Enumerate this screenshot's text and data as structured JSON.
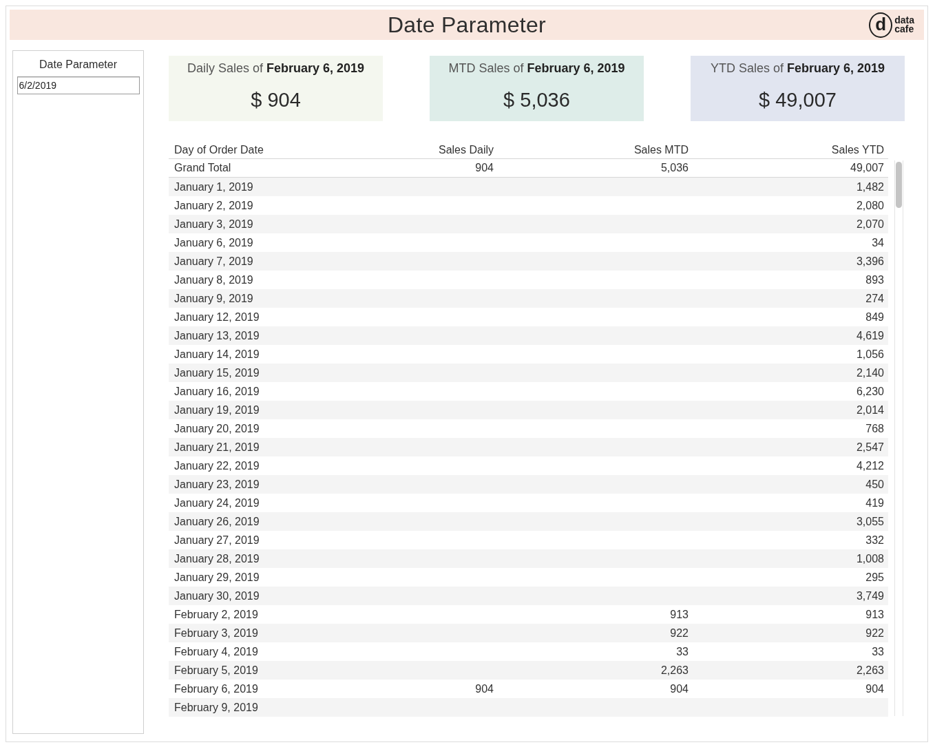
{
  "dashboard": {
    "title": "Date Parameter",
    "logo": {
      "mark": "d",
      "lines": [
        "data",
        "cafe"
      ]
    }
  },
  "parameter": {
    "label": "Date Parameter",
    "value": "6/2/2019"
  },
  "cards": [
    {
      "title": "Daily Sales of **February 6, 2019**",
      "value": "$ 904",
      "color": "#f4f7ef"
    },
    {
      "title": "MTD Sales of **February 6, 2019**",
      "value": "$ 5,036",
      "color": "#deede9"
    },
    {
      "title": "YTD Sales of **February 6, 2019**",
      "value": "$ 49,007",
      "color": "#e1e5f0"
    }
  ],
  "table": {
    "columns": [
      "Day of Order Date",
      "Sales Daily",
      "Sales MTD",
      "Sales YTD"
    ],
    "grand_total": {
      "label": "Grand Total",
      "sales_daily": "904",
      "sales_mtd": "5,036",
      "sales_ytd": "49,007"
    },
    "rows": [
      {
        "date": "January 1, 2019",
        "sales_ytd": "1,482"
      },
      {
        "date": "January 2, 2019",
        "sales_ytd": "2,080"
      },
      {
        "date": "January 3, 2019",
        "sales_ytd": "2,070"
      },
      {
        "date": "January 6, 2019",
        "sales_ytd": "34"
      },
      {
        "date": "January 7, 2019",
        "sales_ytd": "3,396"
      },
      {
        "date": "January 8, 2019",
        "sales_ytd": "893"
      },
      {
        "date": "January 9, 2019",
        "sales_ytd": "274"
      },
      {
        "date": "January 12, 2019",
        "sales_ytd": "849"
      },
      {
        "date": "January 13, 2019",
        "sales_ytd": "4,619"
      },
      {
        "date": "January 14, 2019",
        "sales_ytd": "1,056"
      },
      {
        "date": "January 15, 2019",
        "sales_ytd": "2,140"
      },
      {
        "date": "January 16, 2019",
        "sales_ytd": "6,230"
      },
      {
        "date": "January 19, 2019",
        "sales_ytd": "2,014"
      },
      {
        "date": "January 20, 2019",
        "sales_ytd": "768"
      },
      {
        "date": "January 21, 2019",
        "sales_ytd": "2,547"
      },
      {
        "date": "January 22, 2019",
        "sales_ytd": "4,212"
      },
      {
        "date": "January 23, 2019",
        "sales_ytd": "450"
      },
      {
        "date": "January 24, 2019",
        "sales_ytd": "419"
      },
      {
        "date": "January 26, 2019",
        "sales_ytd": "3,055"
      },
      {
        "date": "January 27, 2019",
        "sales_ytd": "332"
      },
      {
        "date": "January 28, 2019",
        "sales_ytd": "1,008"
      },
      {
        "date": "January 29, 2019",
        "sales_ytd": "295"
      },
      {
        "date": "January 30, 2019",
        "sales_ytd": "3,749"
      },
      {
        "date": "February 2, 2019",
        "sales_mtd": "913",
        "sales_ytd": "913"
      },
      {
        "date": "February 3, 2019",
        "sales_mtd": "922",
        "sales_ytd": "922"
      },
      {
        "date": "February 4, 2019",
        "sales_mtd": "33",
        "sales_ytd": "33"
      },
      {
        "date": "February 5, 2019",
        "sales_mtd": "2,263",
        "sales_ytd": "2,263"
      },
      {
        "date": "February 6, 2019",
        "sales_daily": "904",
        "sales_mtd": "904",
        "sales_ytd": "904"
      },
      {
        "date": "February 9, 2019"
      }
    ]
  }
}
